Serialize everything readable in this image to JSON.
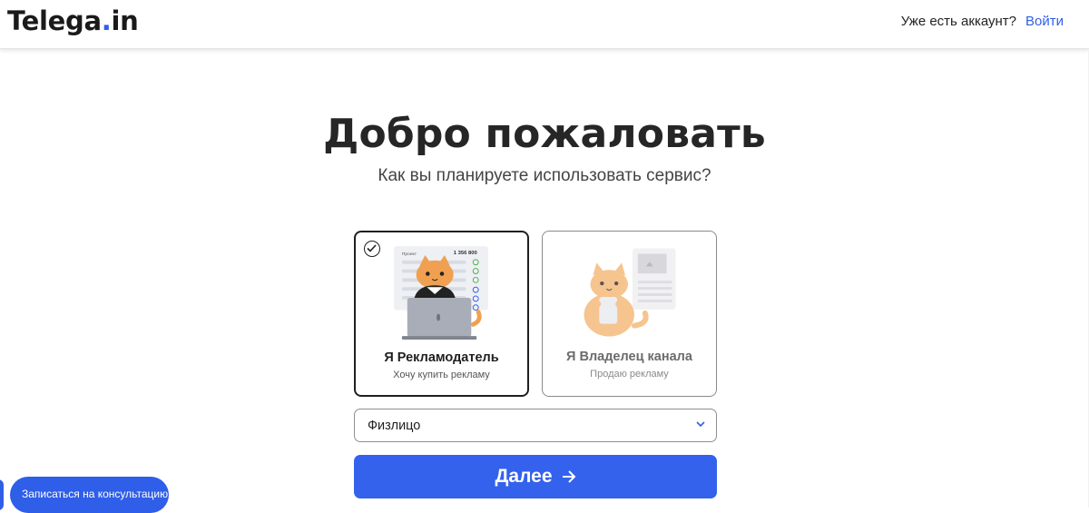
{
  "header": {
    "logo_text": "Telega",
    "logo_dot": ".",
    "logo_suffix": "in",
    "account_question": "Уже есть аккаунт?",
    "login_link": "Войти"
  },
  "main": {
    "title": "Добро пожаловать",
    "subtitle": "Как вы планируете использовать сервис?"
  },
  "roles": [
    {
      "title": "Я Рекламодатель",
      "subtitle": "Хочу купить рекламу",
      "selected": true,
      "illustration": {
        "table_label": "Проект",
        "table_value": "1 356 800"
      }
    },
    {
      "title": "Я Владелец канала",
      "subtitle": "Продаю рекламу",
      "selected": false
    }
  ],
  "entity_select": {
    "value": "Физлицо"
  },
  "next_button": {
    "label": "Далее"
  },
  "consult_button": {
    "label": "Записаться на консультацию"
  },
  "colors": {
    "accent": "#3462ec",
    "cat_orange": "#f0a050",
    "cat_pale": "#f6c48e"
  }
}
